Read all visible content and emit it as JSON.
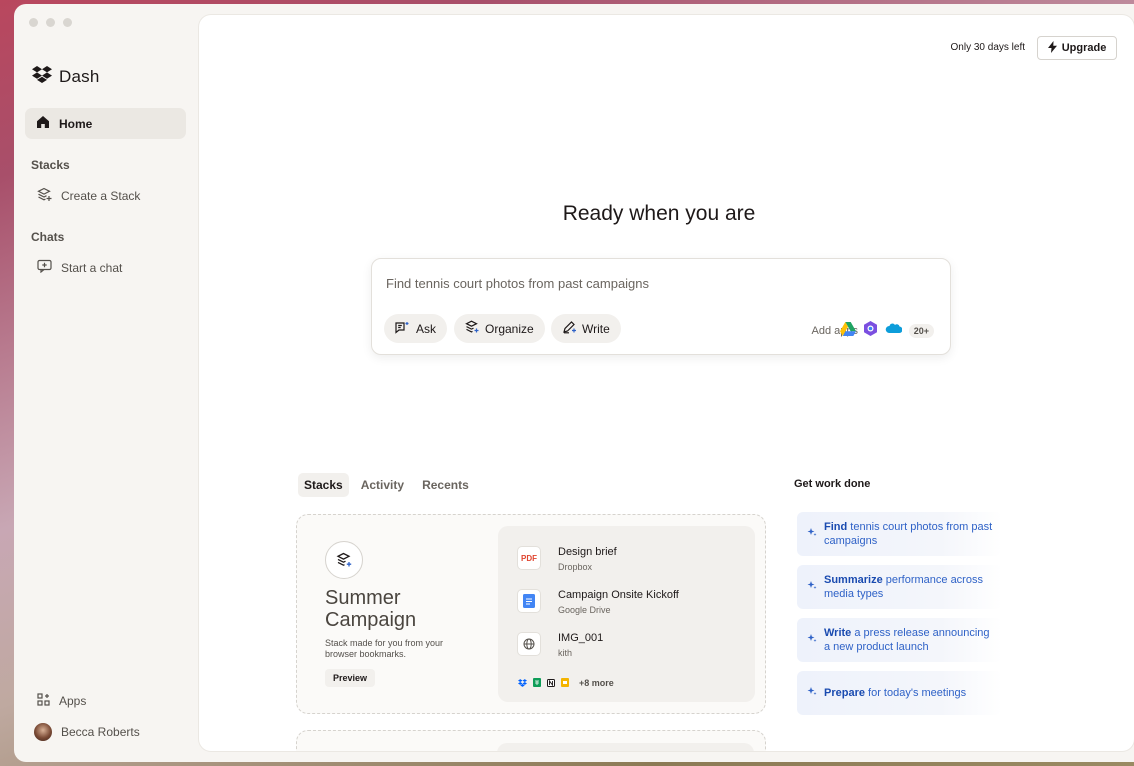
{
  "app": {
    "name": "Dash"
  },
  "sidebar": {
    "home_label": "Home",
    "stacks_section": "Stacks",
    "create_stack_label": "Create a Stack",
    "chats_section": "Chats",
    "start_chat_label": "Start a chat",
    "apps_label": "Apps",
    "user_name": "Becca Roberts"
  },
  "header": {
    "trial_text": "Only 30 days left",
    "upgrade_label": "Upgrade"
  },
  "hero": {
    "title": "Ready when you are"
  },
  "search": {
    "placeholder": "Find tennis court photos from past campaigns",
    "actions": [
      {
        "label": "Ask",
        "icon": "ask-icon"
      },
      {
        "label": "Organize",
        "icon": "stack-icon"
      },
      {
        "label": "Write",
        "icon": "pen-icon"
      }
    ],
    "add_apps_label": "Add apps",
    "more_apps_badge": "20+"
  },
  "tabs": [
    {
      "label": "Stacks",
      "active": true
    },
    {
      "label": "Activity",
      "active": false
    },
    {
      "label": "Recents",
      "active": false
    }
  ],
  "stack_card": {
    "title": "Summer Campaign",
    "description": "Stack made for you from your browser bookmarks.",
    "preview_label": "Preview",
    "files": [
      {
        "name": "Design brief",
        "source": "Dropbox",
        "icon": "pdf-icon",
        "icon_text": "PDF"
      },
      {
        "name": "Campaign Onsite Kickoff",
        "source": "Google Drive",
        "icon": "google-docs-icon",
        "icon_text": ""
      },
      {
        "name": "IMG_001",
        "source": "kith",
        "icon": "globe-icon",
        "icon_text": ""
      }
    ],
    "more_text": "+8 more"
  },
  "get_work_done": {
    "title": "Get work done",
    "suggestions": [
      {
        "verb": "Find",
        "rest": " tennis court photos from past campaigns"
      },
      {
        "verb": "Summarize",
        "rest": " performance across media types"
      },
      {
        "verb": "Write",
        "rest": " a press release announcing a new product launch"
      },
      {
        "verb": "Prepare",
        "rest": " for today's meetings"
      }
    ]
  },
  "colors": {
    "accent_blue": "#2f62c7",
    "sidebar_bg": "#f7f5f2",
    "pdf_red": "#e0452f"
  }
}
